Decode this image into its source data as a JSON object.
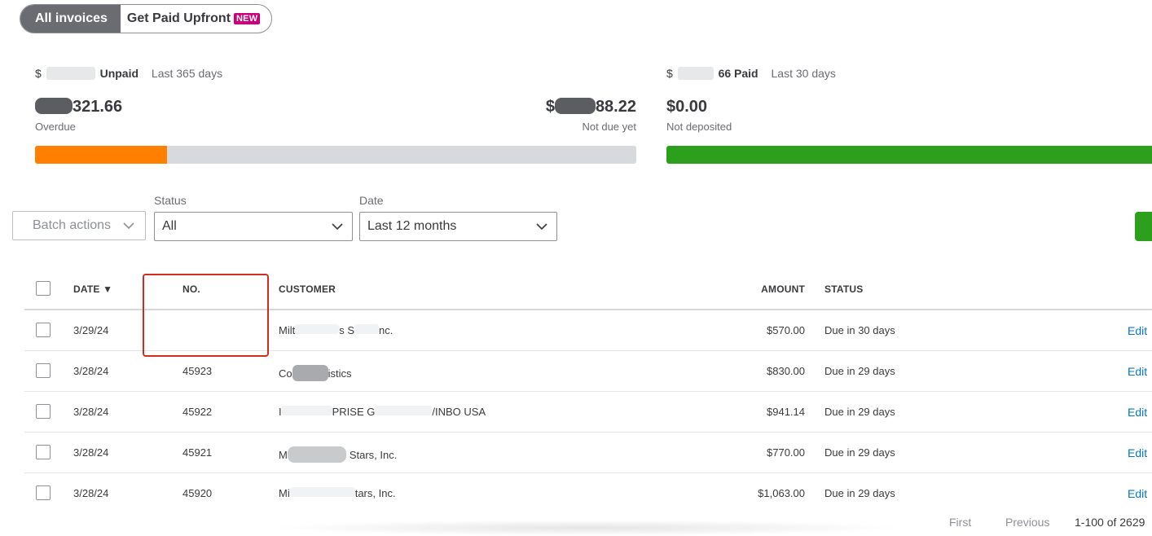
{
  "tabs": {
    "all": "All invoices",
    "paid_upfront": "Get Paid Upfront",
    "new_badge": "NEW"
  },
  "unpaid": {
    "prefix": "$",
    "label": "Unpaid",
    "period": "Last 365 days",
    "overdue_amount_tail": "321.66",
    "overdue_label": "Overdue",
    "not_due_prefix": "$",
    "not_due_amount_tail": "88.22",
    "not_due_label": "Not due yet",
    "overdue_fraction": 0.22
  },
  "paid": {
    "prefix": "$",
    "amount_tail": "66",
    "label": "Paid",
    "period": "Last 30 days",
    "not_deposited_amount": "$0.00",
    "not_deposited_label": "Not deposited",
    "deposited_fraction": 1.0
  },
  "colors": {
    "overdue": "#ff8000",
    "track": "#d8d9dc",
    "paid": "#2ca01c",
    "link": "#0077c5",
    "highlight": "#d52b1e"
  },
  "filters": {
    "batch_label": "Batch actions",
    "status_label": "Status",
    "status_value": "All",
    "date_label": "Date",
    "date_value": "Last 12 months"
  },
  "table": {
    "headers": {
      "date": "DATE ▼",
      "no": "NO.",
      "customer": "CUSTOMER",
      "amount": "AMOUNT",
      "status": "STATUS"
    },
    "rows": [
      {
        "date": "3/29/24",
        "no": "",
        "customer": [
          "Milt",
          "s S",
          "nc."
        ],
        "amount": "$570.00",
        "status": "Due in 30 days",
        "action": "Edit"
      },
      {
        "date": "3/28/24",
        "no": "45923",
        "customer": [
          "Co",
          "istics"
        ],
        "amount": "$830.00",
        "status": "Due in 29 days",
        "action": "Edit"
      },
      {
        "date": "3/28/24",
        "no": "45922",
        "customer": [
          "I",
          "PRISE G",
          "/INBO USA"
        ],
        "amount": "$941.14",
        "status": "Due in 29 days",
        "action": "Edit"
      },
      {
        "date": "3/28/24",
        "no": "45921",
        "customer": [
          "M",
          "Stars, Inc."
        ],
        "amount": "$770.00",
        "status": "Due in 29 days",
        "action": "Edit"
      },
      {
        "date": "3/28/24",
        "no": "45920",
        "customer": [
          "Mi",
          "tars, Inc."
        ],
        "amount": "$1,063.00",
        "status": "Due in 29 days",
        "action": "Edit"
      }
    ]
  },
  "pagination": {
    "first": "First",
    "previous": "Previous",
    "range": "1-100 of 2629"
  }
}
